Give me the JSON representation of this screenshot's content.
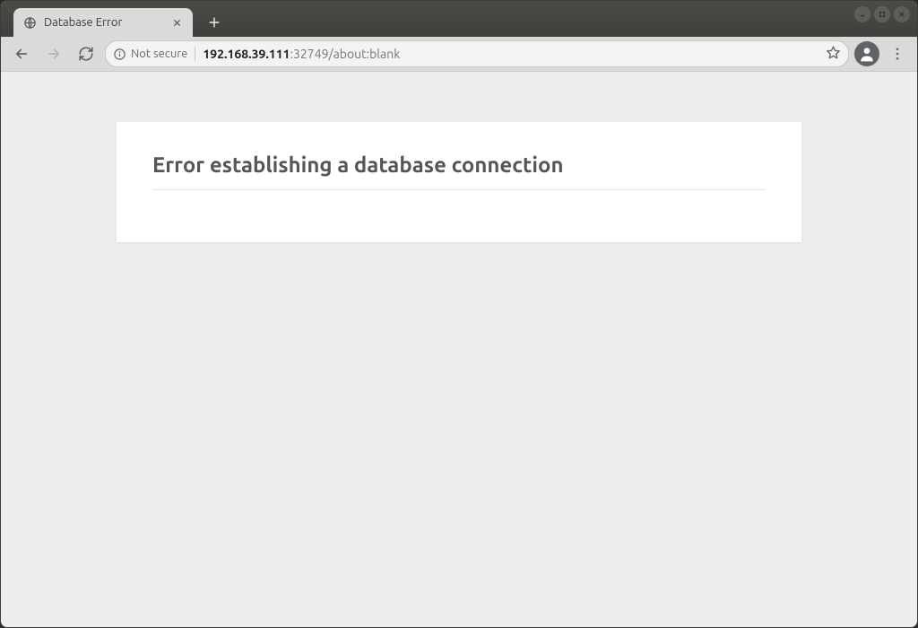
{
  "window": {
    "tab_title": "Database Error"
  },
  "toolbar": {
    "security_label": "Not secure",
    "url_bold": "192.168.39.111",
    "url_rest": ":32749/about:blank"
  },
  "page": {
    "heading": "Error establishing a database connection"
  }
}
